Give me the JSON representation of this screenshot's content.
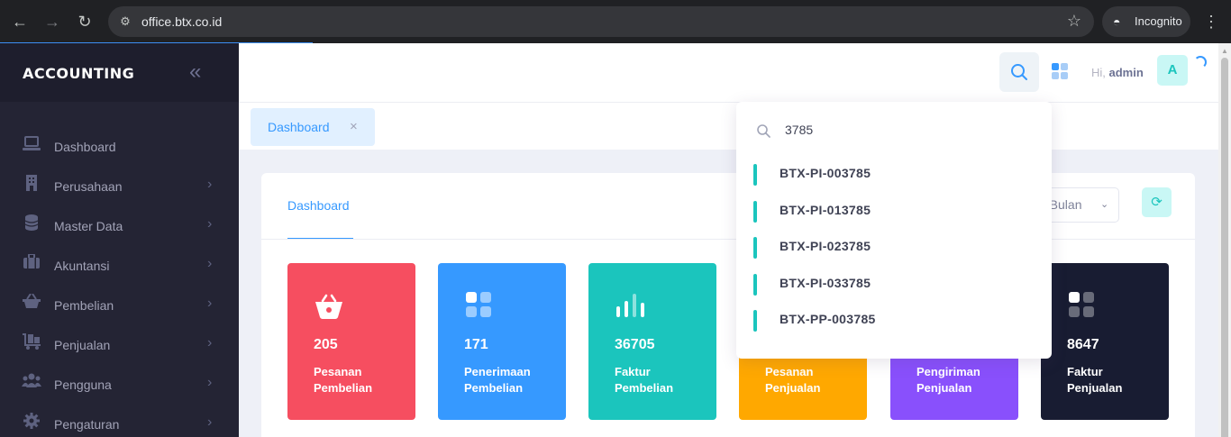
{
  "browser": {
    "url": "office.btx.co.id",
    "incognito_label": "Incognito"
  },
  "sidebar": {
    "brand": "ACCOUNTING",
    "items": [
      {
        "label": "Dashboard"
      },
      {
        "label": "Perusahaan"
      },
      {
        "label": "Master Data"
      },
      {
        "label": "Akuntansi"
      },
      {
        "label": "Pembelian"
      },
      {
        "label": "Penjualan"
      },
      {
        "label": "Pengguna"
      },
      {
        "label": "Pengaturan"
      }
    ]
  },
  "header": {
    "greeting": "Hi,",
    "username": "admin",
    "avatar_letter": "A"
  },
  "tabs": {
    "open_tab": "Dashboard",
    "close_glyph": "×"
  },
  "card": {
    "tab_label": "Dashboard",
    "period_label": "n Bulan"
  },
  "tiles": [
    {
      "value": "205",
      "label_1": "Pesanan",
      "label_2": "Pembelian",
      "color": "#f64e60",
      "icon": "basket-icon"
    },
    {
      "value": "171",
      "label_1": "Penerimaan",
      "label_2": "Pembelian",
      "color": "#3699ff",
      "icon": "grid-icon"
    },
    {
      "value": "36705",
      "label_1": "Faktur",
      "label_2": "Pembelian",
      "color": "#1bc5bd",
      "icon": "bar-chart-icon"
    },
    {
      "value": "",
      "label_1": "Pesanan",
      "label_2": "Penjualan",
      "color": "#ffa800",
      "icon": "cart-icon"
    },
    {
      "value": "",
      "label_1": "Pengiriman",
      "label_2": "Penjualan",
      "color": "#8950fc",
      "icon": "truck-icon"
    },
    {
      "value": "8647",
      "label_1": "Faktur",
      "label_2": "Penjualan",
      "color": "#181c32",
      "icon": "grid-icon"
    }
  ],
  "search": {
    "query": "3785",
    "results": [
      "BTX-PI-003785",
      "BTX-PI-013785",
      "BTX-PI-023785",
      "BTX-PI-033785",
      "BTX-PP-003785"
    ]
  }
}
